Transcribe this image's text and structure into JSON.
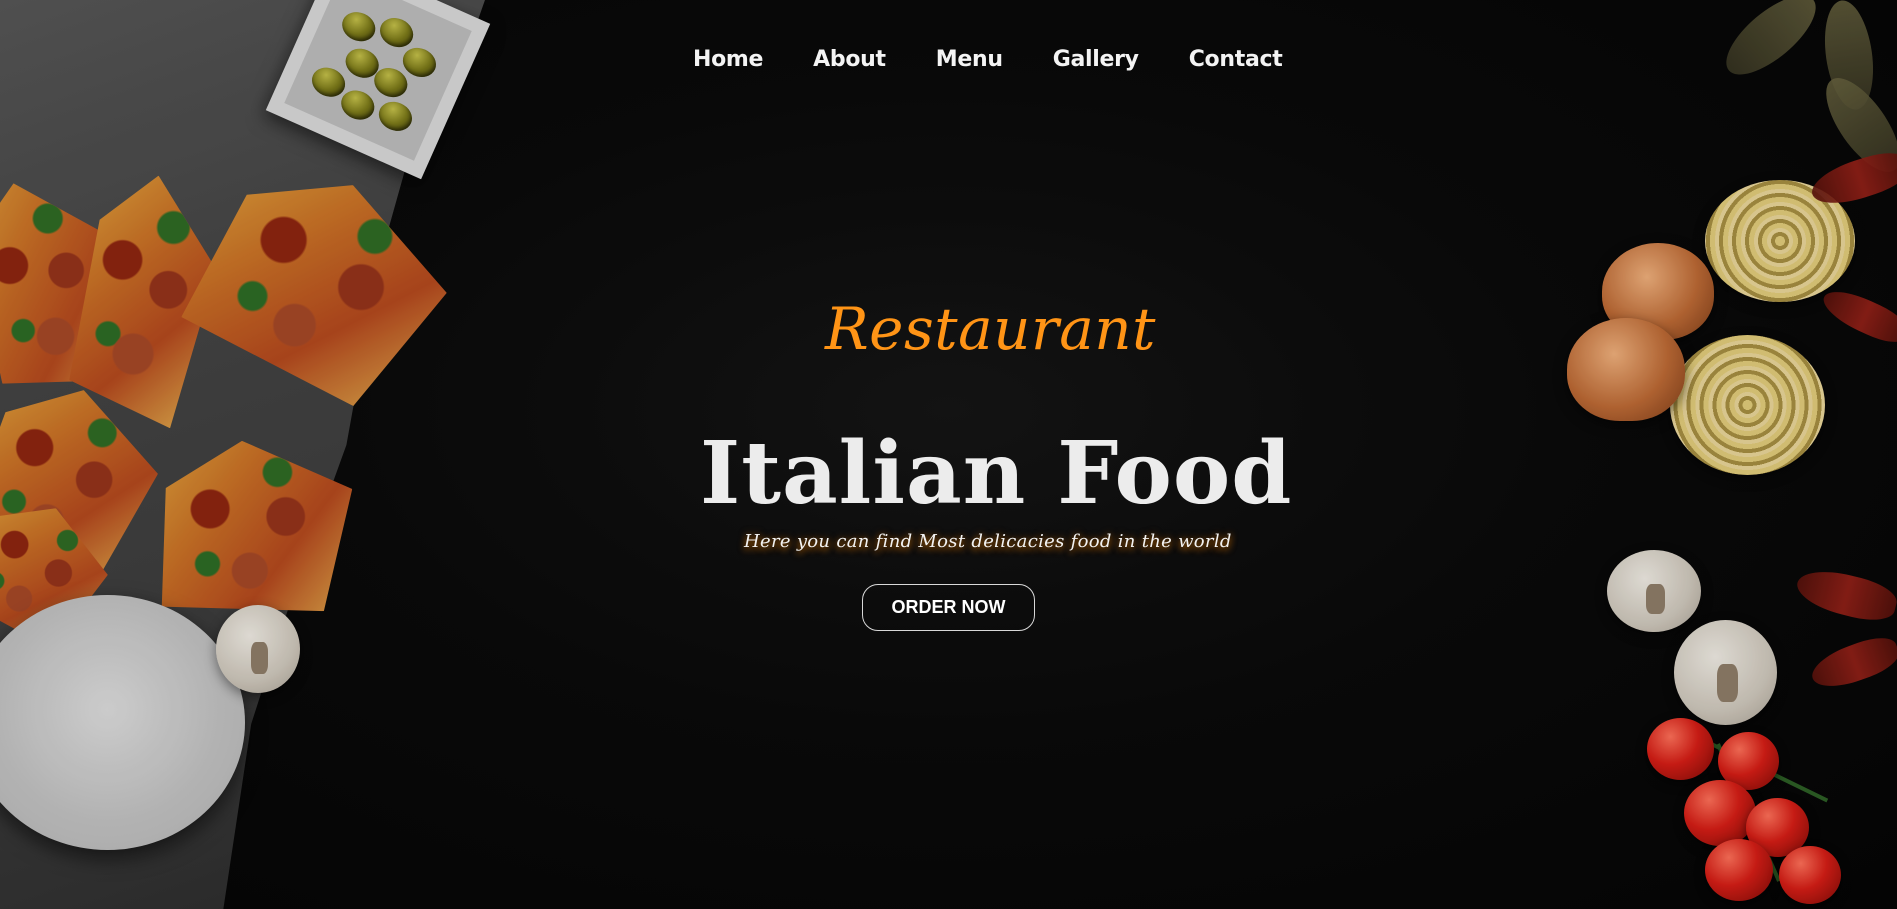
{
  "navigation": {
    "items": [
      {
        "label": "Home"
      },
      {
        "label": "About"
      },
      {
        "label": "Menu"
      },
      {
        "label": "Gallery"
      },
      {
        "label": "Contact"
      }
    ]
  },
  "hero": {
    "eyebrow": "Restaurant",
    "title": "Italian Food",
    "tagline": "Here you can find Most delicacies food in the world",
    "cta_label": "ORDER NOW"
  },
  "colors": {
    "accent": "#ff9416",
    "background": "#070707",
    "text": "#f2f2f2"
  }
}
